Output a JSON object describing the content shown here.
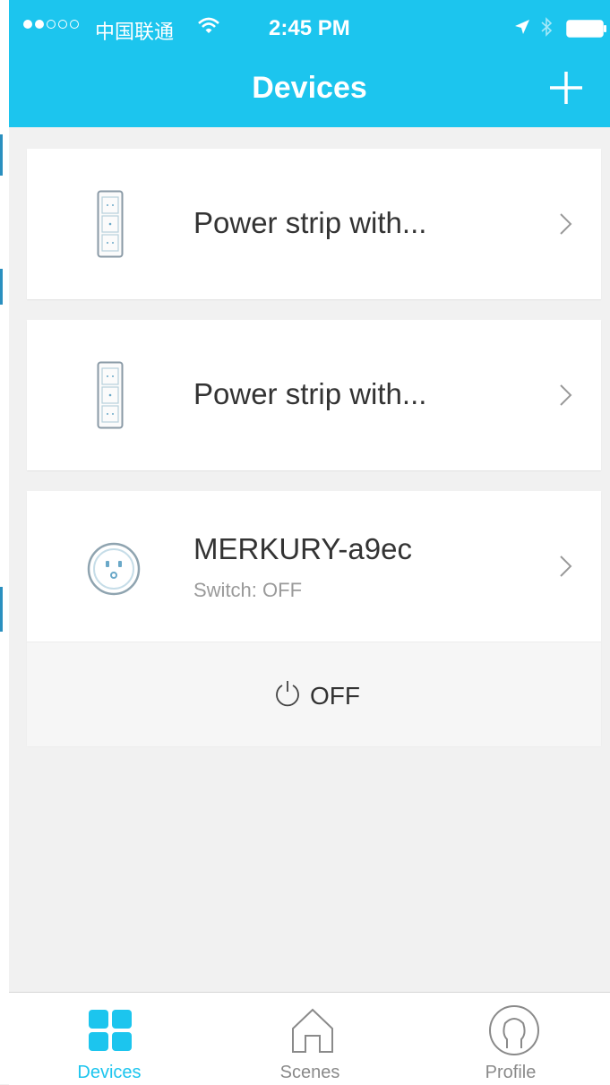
{
  "status_bar": {
    "carrier": "中国联通",
    "time": "2:45 PM"
  },
  "header": {
    "title": "Devices",
    "add_icon": "plus-icon"
  },
  "devices": [
    {
      "name": "Power strip with...",
      "icon": "power-strip-icon"
    },
    {
      "name": "Power strip with...",
      "icon": "power-strip-icon"
    },
    {
      "name": "MERKURY-a9ec",
      "status": "Switch: OFF",
      "icon": "smart-plug-icon",
      "power_label": "OFF"
    }
  ],
  "tabs": [
    {
      "label": "Devices",
      "icon": "grid-icon",
      "active": true
    },
    {
      "label": "Scenes",
      "icon": "home-icon",
      "active": false
    },
    {
      "label": "Profile",
      "icon": "person-icon",
      "active": false
    }
  ],
  "colors": {
    "accent": "#1cc5ee",
    "background": "#f1f1f1",
    "inactive_tab": "#8a8a8a"
  }
}
